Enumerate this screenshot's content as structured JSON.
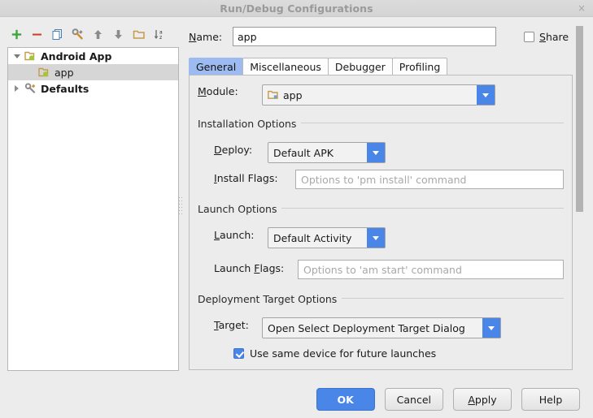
{
  "window": {
    "title": "Run/Debug Configurations",
    "close_label": "×"
  },
  "toolbar": {
    "items": [
      {
        "name": "add-icon",
        "tooltip": "Add New Configuration"
      },
      {
        "name": "remove-icon",
        "tooltip": "Remove Configuration"
      },
      {
        "name": "copy-icon",
        "tooltip": "Copy Configuration"
      },
      {
        "name": "edit-templates-icon",
        "tooltip": "Edit Templates"
      },
      {
        "name": "move-up-icon",
        "tooltip": "Move Up"
      },
      {
        "name": "move-down-icon",
        "tooltip": "Move Down"
      },
      {
        "name": "folder-icon",
        "tooltip": "Create New Folder"
      },
      {
        "name": "sort-alpha-icon",
        "tooltip": "Sort Configurations"
      }
    ]
  },
  "tree": {
    "nodes": [
      {
        "label": "Android App",
        "level": 0,
        "expanded": true,
        "icon": "android-folder-icon",
        "selected": false,
        "bold": true
      },
      {
        "label": "app",
        "level": 1,
        "expanded": null,
        "icon": "android-folder-icon",
        "selected": true,
        "bold": false
      },
      {
        "label": "Defaults",
        "level": 0,
        "expanded": false,
        "icon": "wrench-icon",
        "selected": false,
        "bold": true
      }
    ]
  },
  "name_field": {
    "label": "Name:",
    "label_mnemonic": "N",
    "value": "app",
    "placeholder": ""
  },
  "share": {
    "label": "Share",
    "label_mnemonic": "S",
    "checked": false
  },
  "tabs": [
    {
      "label": "General",
      "active": true
    },
    {
      "label": "Miscellaneous",
      "active": false
    },
    {
      "label": "Debugger",
      "active": false
    },
    {
      "label": "Profiling",
      "active": false
    }
  ],
  "general": {
    "module": {
      "label": "Module:",
      "label_mnemonic": "M",
      "value": "app",
      "icon": "module-folder-icon"
    },
    "installation_options": {
      "title": "Installation Options",
      "deploy": {
        "label": "Deploy:",
        "label_mnemonic": "D",
        "value": "Default APK"
      },
      "install_flags": {
        "label": "Install Flags:",
        "label_mnemonic": "I",
        "value": "",
        "placeholder": "Options to 'pm install' command"
      }
    },
    "launch_options": {
      "title": "Launch Options",
      "launch": {
        "label": "Launch:",
        "label_mnemonic": "L",
        "value": "Default Activity"
      },
      "launch_flags": {
        "label": "Launch Flags:",
        "label_mnemonic": "F",
        "value": "",
        "placeholder": "Options to 'am start' command"
      }
    },
    "deployment_target_options": {
      "title": "Deployment Target Options",
      "target": {
        "label": "Target:",
        "label_mnemonic": "T",
        "value": "Open Select Deployment Target Dialog"
      },
      "use_same_device": {
        "label": "Use same device for future launches",
        "checked": true
      }
    }
  },
  "buttons": {
    "ok": "OK",
    "cancel": "Cancel",
    "apply": "Apply",
    "apply_mnemonic": "A",
    "help": "Help"
  },
  "colors": {
    "accent": "#4a86e8",
    "tab_active": "#9dbbf0",
    "dialog_bg": "#ececec",
    "selection": "#d6d6d6"
  }
}
